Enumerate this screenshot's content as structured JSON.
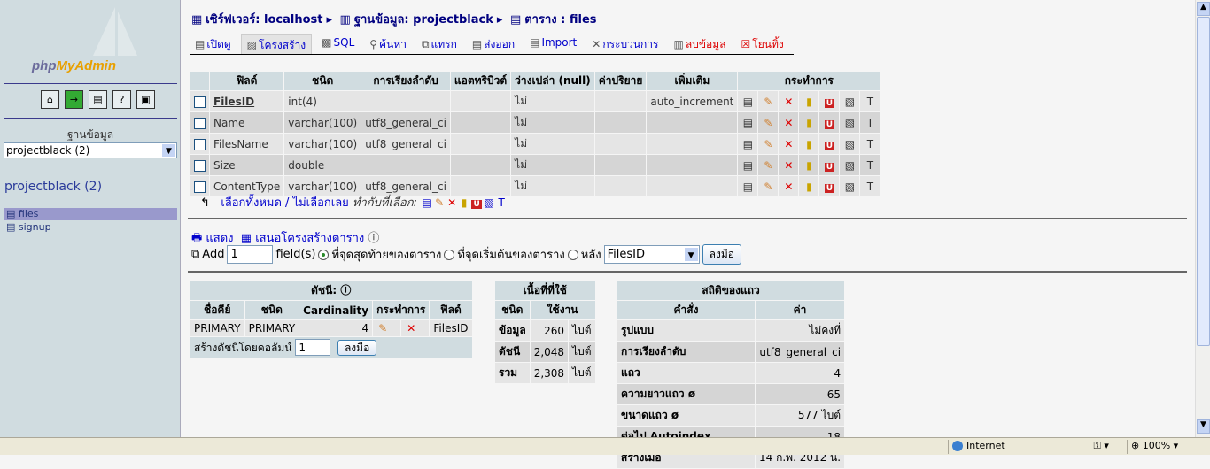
{
  "sidebar": {
    "logo": "phpMyAdmin",
    "logo_a": "php",
    "logo_b": "MyAdmin",
    "db_label": "ฐานข้อมูล",
    "db_select": "projectblack (2)",
    "db_name": "projectblack (2)",
    "tables": [
      "files",
      "signup"
    ]
  },
  "breadcrumb": {
    "server": "เซิร์ฟเวอร์: localhost",
    "database": "ฐานข้อมูล: projectblack",
    "table": "ตาราง : files"
  },
  "tabs": [
    "เปิดดู",
    "โครงสร้าง",
    "SQL",
    "ค้นหา",
    "แทรก",
    "ส่งออก",
    "Import",
    "กระบวนการ",
    "ลบข้อมูล",
    "โยนทิ้ง"
  ],
  "fields": {
    "headers": [
      "ฟิลด์",
      "ชนิด",
      "การเรียงลำดับ",
      "แอตทริบิวต์",
      "ว่างเปล่า (null)",
      "ค่าปริยาย",
      "เพิ่มเติม",
      "กระทำการ"
    ],
    "rows": [
      {
        "field": "FilesID",
        "type": "int(4)",
        "collation": "",
        "attr": "",
        "null": "ไม่",
        "default": "",
        "extra": "auto_increment"
      },
      {
        "field": "Name",
        "type": "varchar(100)",
        "collation": "utf8_general_ci",
        "attr": "",
        "null": "ไม่",
        "default": "",
        "extra": ""
      },
      {
        "field": "FilesName",
        "type": "varchar(100)",
        "collation": "utf8_general_ci",
        "attr": "",
        "null": "ไม่",
        "default": "",
        "extra": ""
      },
      {
        "field": "Size",
        "type": "double",
        "collation": "",
        "attr": "",
        "null": "ไม่",
        "default": "",
        "extra": ""
      },
      {
        "field": "ContentType",
        "type": "varchar(100)",
        "collation": "utf8_general_ci",
        "attr": "",
        "null": "ไม่",
        "default": "",
        "extra": ""
      }
    ]
  },
  "selection": {
    "check_all": "เลือกทั้งหมด",
    "sep": " / ",
    "uncheck_all": "ไม่เลือกเลย",
    "with_selected": "ทำกับที่เลือก:"
  },
  "links": {
    "print": "แสดง",
    "propose": "เสนอโครงสร้างตาราง"
  },
  "add_field": {
    "label": "Add",
    "count": "1",
    "suffix": "field(s)",
    "opt_end": "ที่จุดสุดท้ายของตาราง",
    "opt_begin": "ที่จุดเริ่มต้นของตาราง",
    "opt_after": "หลัง",
    "after_field": "FilesID",
    "go": "ลงมือ"
  },
  "indexes": {
    "title": "ดัชนี:",
    "headers": [
      "ชื่อคีย์",
      "ชนิด",
      "Cardinality",
      "กระทำการ",
      "ฟิลด์"
    ],
    "row": {
      "key": "PRIMARY",
      "type": "PRIMARY",
      "cardinality": "4",
      "field": "FilesID"
    },
    "create_label": "สร้างดัชนีโดยคอลัมน์",
    "create_count": "1",
    "go": "ลงมือ"
  },
  "space": {
    "title": "เนื้อที่ที่ใช้",
    "headers": [
      "ชนิด",
      "ใช้งาน"
    ],
    "rows": [
      {
        "type": "ข้อมูล",
        "value": "260",
        "unit": "ไบต์"
      },
      {
        "type": "ดัชนี",
        "value": "2,048",
        "unit": "ไบต์"
      },
      {
        "type": "รวม",
        "value": "2,308",
        "unit": "ไบต์"
      }
    ]
  },
  "stats": {
    "title": "สถิติของแถว",
    "headers": [
      "คำสั่ง",
      "ค่า"
    ],
    "rows": [
      {
        "k": "รูปแบบ",
        "v": "ไม่คงที่"
      },
      {
        "k": "การเรียงลำดับ",
        "v": "utf8_general_ci"
      },
      {
        "k": "แถว",
        "v": "4"
      },
      {
        "k": "ความยาวแถว ø",
        "v": "65"
      },
      {
        "k": "ขนาดแถว ø",
        "v": "577 ไบต์"
      },
      {
        "k": "ต่อไป Autoindex",
        "v": "18"
      },
      {
        "k": "สร้างเมื่อ",
        "v": "14 ก.พ. 2012 น."
      }
    ]
  },
  "statusbar": {
    "zone": "Internet",
    "zoom": "100%"
  }
}
